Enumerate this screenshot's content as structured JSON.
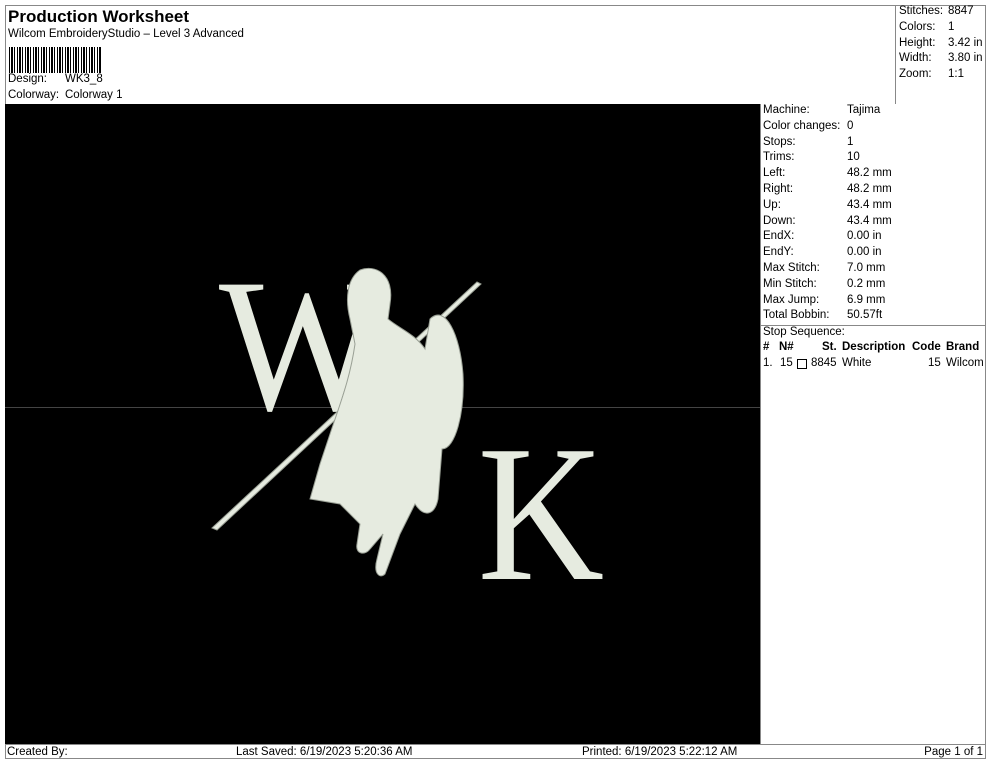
{
  "header": {
    "title": "Production Worksheet",
    "subtitle": "Wilcom EmbroideryStudio – Level 3 Advanced",
    "design_label": "Design:",
    "design_value": "WK3_8",
    "colorway_label": "Colorway:",
    "colorway_value": "Colorway 1"
  },
  "stats": [
    {
      "label": "Stitches:",
      "value": "8847"
    },
    {
      "label": "Colors:",
      "value": "1"
    },
    {
      "label": "Height:",
      "value": "3.42 in"
    },
    {
      "label": "Width:",
      "value": "3.80 in"
    },
    {
      "label": "Zoom:",
      "value": "1:1"
    }
  ],
  "machine": [
    {
      "label": "Machine:",
      "value": "Tajima"
    },
    {
      "label": "Color changes:",
      "value": "0"
    },
    {
      "label": "Stops:",
      "value": "1"
    },
    {
      "label": "Trims:",
      "value": "10"
    },
    {
      "label": "Left:",
      "value": "48.2 mm"
    },
    {
      "label": "Right:",
      "value": "48.2 mm"
    },
    {
      "label": "Up:",
      "value": "43.4 mm"
    },
    {
      "label": "Down:",
      "value": "43.4 mm"
    },
    {
      "label": "EndX:",
      "value": "0.00 in"
    },
    {
      "label": "EndY:",
      "value": "0.00 in"
    },
    {
      "label": "Max Stitch:",
      "value": "7.0 mm"
    },
    {
      "label": "Min Stitch:",
      "value": "0.2 mm"
    },
    {
      "label": "Max Jump:",
      "value": "6.9 mm"
    },
    {
      "label": "Total Bobbin:",
      "value": "50.57ft"
    }
  ],
  "stop_sequence": {
    "title": "Stop Sequence:",
    "headers": [
      "#",
      "N#",
      "St.",
      "Description",
      "Code",
      "Brand"
    ],
    "rows": [
      {
        "num": "1.",
        "n": "15",
        "st": "8845",
        "desc": "White",
        "code": "15",
        "brand": "Wilcom",
        "swatch": "#ffffff"
      }
    ]
  },
  "design": {
    "letters": [
      "W",
      "K"
    ],
    "thread_color": "#e6ebe0",
    "background": "#000000"
  },
  "footer": {
    "created": "Created By:",
    "saved": "Last Saved: 6/19/2023 5:20:36 AM",
    "printed": "Printed: 6/19/2023 5:22:12 AM",
    "page": "Page 1 of 1"
  }
}
